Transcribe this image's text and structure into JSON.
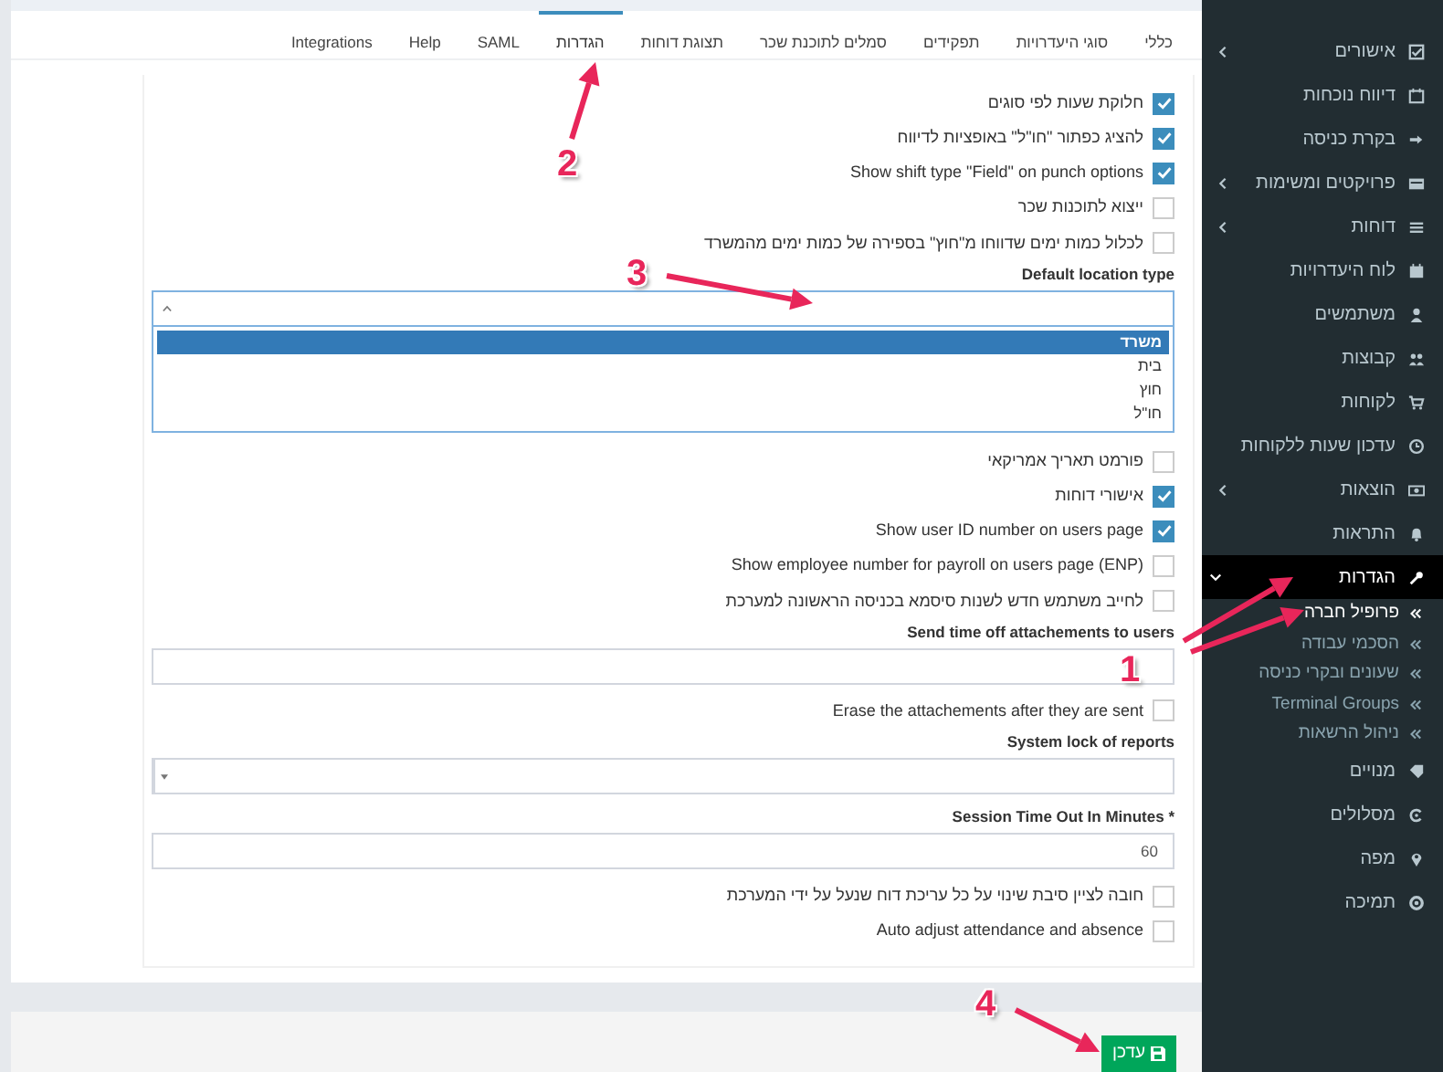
{
  "tabs": [
    {
      "label": "כללי",
      "selected": false
    },
    {
      "label": "סוגי היעדרויות",
      "selected": false
    },
    {
      "label": "תפקידים",
      "selected": false
    },
    {
      "label": "סמלים לתוכנת שכר",
      "selected": false
    },
    {
      "label": "תצוגת דוחות",
      "selected": false
    },
    {
      "label": "הגדרות",
      "selected": true
    },
    {
      "label": "SAML",
      "selected": false
    },
    {
      "label": "Help",
      "selected": false
    },
    {
      "label": "Integrations",
      "selected": false
    }
  ],
  "fields": [
    {
      "kind": "checkbox",
      "label": "חלוקת שעות לפי סוגים",
      "checked": true
    },
    {
      "kind": "checkbox",
      "label": "להציג כפתור \"חו\"ל\" באופציות לדיווח",
      "checked": true
    },
    {
      "kind": "checkbox",
      "label": "Show shift type \"Field\" on punch options",
      "checked": true
    },
    {
      "kind": "checkbox",
      "label": "ייצוא לתוכנות שכר",
      "checked": false
    },
    {
      "kind": "checkbox",
      "label": "לכלול כמות ימים שדווחו מ\"חוץ\" בספירה של כמות ימים מהמשרד",
      "checked": false
    },
    {
      "kind": "dropdown",
      "label": "Default location type",
      "options": [
        {
          "label": "משרד",
          "selected": true
        },
        {
          "label": "בית",
          "selected": false
        },
        {
          "label": "חוץ",
          "selected": false
        },
        {
          "label": "חו\"ל",
          "selected": false
        }
      ]
    },
    {
      "kind": "checkbox",
      "label": "פורמט תאריך אמריקאי",
      "checked": false
    },
    {
      "kind": "checkbox",
      "label": "אישורי דוחות",
      "checked": true
    },
    {
      "kind": "checkbox",
      "label": "Show user ID number on users page",
      "checked": true
    },
    {
      "kind": "checkbox",
      "label": "Show employee number for payroll on users page (ENP)",
      "checked": false
    },
    {
      "kind": "checkbox",
      "label": "לחייב משתמש חדש לשנות סיסמא בכניסה הראשונה למערכת",
      "checked": false
    },
    {
      "kind": "text",
      "label": "Send time off attachements to users"
    },
    {
      "kind": "checkbox",
      "label": "Erase the attachements after they are sent",
      "checked": false
    },
    {
      "kind": "select",
      "label": "System lock of reports"
    },
    {
      "kind": "text",
      "label": "* Session Time Out In Minutes",
      "value": "60"
    },
    {
      "kind": "checkbox",
      "label": "חובה לציין סיבת שינוי על כל עריכת דוח שנעל על ידי המערכת",
      "checked": false
    },
    {
      "kind": "checkbox",
      "label": "Auto adjust attendance and absence",
      "checked": false
    }
  ],
  "save_button": {
    "label": "עדכן"
  },
  "sidebar": {
    "items": [
      {
        "label": "אישורים",
        "selected": false,
        "expanded": false
      },
      {
        "label": "דיווח נוכחות",
        "selected": false
      },
      {
        "label": "בקרת כניסה",
        "selected": false
      },
      {
        "label": "פרויקטים ומשימות",
        "selected": false,
        "expanded": false
      },
      {
        "label": "דוחות",
        "selected": false,
        "expanded": false
      },
      {
        "label": "לוח היעדרויות",
        "selected": false
      },
      {
        "label": "משתמשים",
        "selected": false
      },
      {
        "label": "קבוצות",
        "selected": false
      },
      {
        "label": "לקוחות",
        "selected": false
      },
      {
        "label": "עדכון שעות ללקוחות",
        "selected": false
      },
      {
        "label": "הוצאות",
        "selected": false,
        "expanded": false
      },
      {
        "label": "התראות",
        "selected": false
      },
      {
        "label": "הגדרות",
        "selected": true,
        "expanded": true,
        "children": [
          {
            "label": "פרופיל חברה",
            "selected": true
          },
          {
            "label": "הסכמי עבודה",
            "selected": false
          },
          {
            "label": "שעונים ובקרי כניסה",
            "selected": false
          },
          {
            "label": "Terminal Groups",
            "selected": false
          },
          {
            "label": "ניהול הרשאות",
            "selected": false
          }
        ]
      },
      {
        "label": "מנויים",
        "selected": false
      },
      {
        "label": "מסלולים",
        "selected": false
      },
      {
        "label": "מפה",
        "selected": false
      },
      {
        "label": "תמיכה",
        "selected": false
      }
    ]
  },
  "annotations": [
    {
      "label": "2"
    },
    {
      "label": "3"
    },
    {
      "label": "1"
    },
    {
      "label": "4"
    }
  ]
}
